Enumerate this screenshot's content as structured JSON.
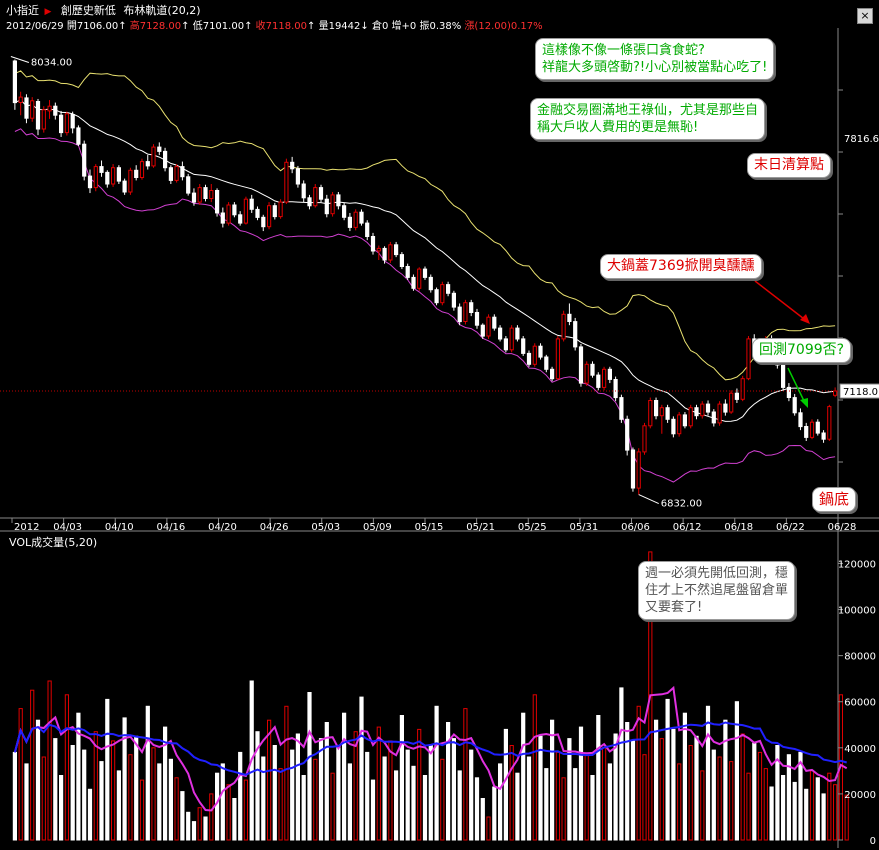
{
  "header": {
    "symbol": "小指近",
    "title": "創歷史新低",
    "indicator": "布林軌道(20,2)",
    "quote": {
      "date": "2012/06/29",
      "open_label": "開7106.00",
      "high_label": "高7128.00",
      "low_label": "低7101.00",
      "close_label": "收7118.00",
      "volume_label": "量19442",
      "oi_label": "倉0",
      "inc_label": "增+0",
      "amp_label": "振0.38%",
      "chg_label": "漲(12.00)0.17%"
    }
  },
  "volume_label": "VOL成交量(5,20)",
  "annotations": {
    "note1": "這樣像不像一條張口貪食蛇?\n祥龍大多頭啓動?!小心別被當點心吃了!",
    "note2": "金融交易圈滿地王祿仙，尤其是那些自\n稱大戶收人費用的更是無恥!",
    "note3": "末日清算點",
    "note4": "大鍋蓋7369掀開臭醺醺",
    "note5": "回測7099否?",
    "note6": "鍋底",
    "note7": "週一必須先開低回測，穩\n住才上不然追尾盤留倉單\n又要套了!",
    "peak_label": "8034.00",
    "trough_label": "6832.00",
    "right_price_label": "7816.6",
    "last_price_label": "7118.0"
  },
  "colors": {
    "up": "#e00000",
    "down": "#ffffff",
    "upper_band": "#e8e070",
    "middle_band": "#ffffff",
    "lower_band": "#d040d0",
    "ma5": "#e030e0",
    "ma20": "#2020ff",
    "green_text": "#00aa00",
    "red_text": "#dd0000"
  },
  "chart_data": [
    {
      "type": "candlestick",
      "x_ticks": [
        "2012",
        "04/03",
        "04/10",
        "04/16",
        "04/20",
        "04/26",
        "05/03",
        "05/09",
        "05/15",
        "05/21",
        "05/25",
        "05/31",
        "06/06",
        "06/12",
        "06/18",
        "06/22",
        "06/28"
      ],
      "ohlc": [
        [
          8030,
          8034,
          7895,
          7915
        ],
        [
          7915,
          7945,
          7880,
          7930
        ],
        [
          7928,
          7938,
          7858,
          7872
        ],
        [
          7872,
          7930,
          7862,
          7920
        ],
        [
          7918,
          7925,
          7825,
          7842
        ],
        [
          7842,
          7905,
          7832,
          7895
        ],
        [
          7892,
          7922,
          7870,
          7905
        ],
        [
          7905,
          7915,
          7868,
          7880
        ],
        [
          7880,
          7892,
          7820,
          7832
        ],
        [
          7832,
          7890,
          7824,
          7884
        ],
        [
          7882,
          7890,
          7830,
          7845
        ],
        [
          7845,
          7852,
          7795,
          7800
        ],
        [
          7800,
          7810,
          7700,
          7712
        ],
        [
          7712,
          7730,
          7665,
          7680
        ],
        [
          7680,
          7745,
          7670,
          7738
        ],
        [
          7738,
          7755,
          7710,
          7722
        ],
        [
          7722,
          7728,
          7680,
          7690
        ],
        [
          7690,
          7745,
          7682,
          7735
        ],
        [
          7735,
          7742,
          7690,
          7698
        ],
        [
          7698,
          7705,
          7660,
          7668
        ],
        [
          7668,
          7735,
          7660,
          7728
        ],
        [
          7728,
          7742,
          7700,
          7708
        ],
        [
          7708,
          7760,
          7702,
          7752
        ],
        [
          7752,
          7770,
          7730,
          7740
        ],
        [
          7740,
          7800,
          7735,
          7792
        ],
        [
          7792,
          7805,
          7770,
          7780
        ],
        [
          7780,
          7790,
          7725,
          7735
        ],
        [
          7735,
          7742,
          7690,
          7700
        ],
        [
          7700,
          7745,
          7694,
          7738
        ],
        [
          7738,
          7752,
          7700,
          7710
        ],
        [
          7710,
          7718,
          7658,
          7665
        ],
        [
          7665,
          7678,
          7630,
          7640
        ],
        [
          7640,
          7690,
          7632,
          7680
        ],
        [
          7680,
          7688,
          7642,
          7650
        ],
        [
          7650,
          7690,
          7640,
          7672
        ],
        [
          7672,
          7678,
          7600,
          7610
        ],
        [
          7610,
          7625,
          7570,
          7582
        ],
        [
          7582,
          7640,
          7575,
          7632
        ],
        [
          7632,
          7640,
          7598,
          7605
        ],
        [
          7605,
          7615,
          7575,
          7582
        ],
        [
          7582,
          7655,
          7578,
          7648
        ],
        [
          7648,
          7660,
          7610,
          7620
        ],
        [
          7620,
          7628,
          7590,
          7598
        ],
        [
          7598,
          7605,
          7560,
          7572
        ],
        [
          7572,
          7640,
          7565,
          7630
        ],
        [
          7630,
          7638,
          7592,
          7600
        ],
        [
          7600,
          7648,
          7594,
          7640
        ],
        [
          7640,
          7760,
          7635,
          7750
        ],
        [
          7750,
          7765,
          7720,
          7732
        ],
        [
          7732,
          7740,
          7680,
          7690
        ],
        [
          7690,
          7700,
          7640,
          7652
        ],
        [
          7652,
          7660,
          7620,
          7630
        ],
        [
          7630,
          7690,
          7625,
          7680
        ],
        [
          7680,
          7688,
          7640,
          7648
        ],
        [
          7648,
          7660,
          7598,
          7608
        ],
        [
          7608,
          7668,
          7600,
          7660
        ],
        [
          7660,
          7668,
          7620,
          7630
        ],
        [
          7630,
          7638,
          7590,
          7598
        ],
        [
          7598,
          7610,
          7560,
          7570
        ],
        [
          7570,
          7620,
          7562,
          7612
        ],
        [
          7612,
          7620,
          7575,
          7582
        ],
        [
          7582,
          7590,
          7535,
          7545
        ],
        [
          7545,
          7555,
          7495,
          7505
        ],
        [
          7505,
          7520,
          7480,
          7512
        ],
        [
          7512,
          7518,
          7470,
          7480
        ],
        [
          7480,
          7530,
          7472,
          7522
        ],
        [
          7522,
          7530,
          7488,
          7495
        ],
        [
          7495,
          7502,
          7455,
          7462
        ],
        [
          7462,
          7470,
          7425,
          7432
        ],
        [
          7432,
          7440,
          7395,
          7402
        ],
        [
          7402,
          7460,
          7395,
          7455
        ],
        [
          7455,
          7462,
          7425,
          7432
        ],
        [
          7432,
          7440,
          7390,
          7398
        ],
        [
          7398,
          7404,
          7355,
          7362
        ],
        [
          7362,
          7420,
          7355,
          7412
        ],
        [
          7412,
          7420,
          7380,
          7388
        ],
        [
          7388,
          7395,
          7340,
          7350
        ],
        [
          7350,
          7360,
          7300,
          7310
        ],
        [
          7310,
          7370,
          7302,
          7362
        ],
        [
          7362,
          7370,
          7325,
          7335
        ],
        [
          7335,
          7345,
          7290,
          7300
        ],
        [
          7300,
          7305,
          7262,
          7270
        ],
        [
          7270,
          7330,
          7262,
          7322
        ],
        [
          7322,
          7330,
          7285,
          7292
        ],
        [
          7292,
          7300,
          7255,
          7262
        ],
        [
          7262,
          7270,
          7225,
          7232
        ],
        [
          7232,
          7300,
          7225,
          7292
        ],
        [
          7292,
          7300,
          7255,
          7262
        ],
        [
          7262,
          7270,
          7215,
          7222
        ],
        [
          7222,
          7230,
          7185,
          7192
        ],
        [
          7192,
          7250,
          7185,
          7242
        ],
        [
          7242,
          7250,
          7205,
          7212
        ],
        [
          7212,
          7218,
          7170,
          7178
        ],
        [
          7178,
          7185,
          7145,
          7152
        ],
        [
          7152,
          7270,
          7148,
          7262
        ],
        [
          7262,
          7340,
          7255,
          7330
        ],
        [
          7330,
          7360,
          7300,
          7310
        ],
        [
          7310,
          7320,
          7230,
          7240
        ],
        [
          7240,
          7248,
          7130,
          7140
        ],
        [
          7140,
          7200,
          7132,
          7192
        ],
        [
          7192,
          7200,
          7155,
          7162
        ],
        [
          7162,
          7170,
          7120,
          7128
        ],
        [
          7128,
          7185,
          7120,
          7178
        ],
        [
          7178,
          7185,
          7140,
          7150
        ],
        [
          7150,
          7158,
          7090,
          7100
        ],
        [
          7100,
          7108,
          7030,
          7040
        ],
        [
          7040,
          7050,
          6940,
          6955
        ],
        [
          6955,
          6962,
          6840,
          6850
        ],
        [
          6850,
          6960,
          6832,
          6950
        ],
        [
          6950,
          7030,
          6942,
          7022
        ],
        [
          7022,
          7100,
          7015,
          7092
        ],
        [
          7092,
          7100,
          7040,
          7050
        ],
        [
          7050,
          7080,
          7000,
          7072
        ],
        [
          7072,
          7080,
          7030,
          7040
        ],
        [
          7040,
          7048,
          6990,
          7000
        ],
        [
          7000,
          7060,
          6992,
          7052
        ],
        [
          7052,
          7060,
          7015,
          7022
        ],
        [
          7022,
          7080,
          7015,
          7072
        ],
        [
          7072,
          7080,
          7040,
          7050
        ],
        [
          7050,
          7090,
          7042,
          7082
        ],
        [
          7082,
          7092,
          7050,
          7060
        ],
        [
          7060,
          7068,
          7020,
          7030
        ],
        [
          7030,
          7090,
          7022,
          7082
        ],
        [
          7082,
          7095,
          7050,
          7060
        ],
        [
          7060,
          7120,
          7055,
          7112
        ],
        [
          7112,
          7125,
          7085,
          7095
        ],
        [
          7095,
          7160,
          7090,
          7152
        ],
        [
          7152,
          7270,
          7148,
          7262
        ],
        [
          7262,
          7275,
          7220,
          7230
        ],
        [
          7230,
          7250,
          7210,
          7242
        ],
        [
          7242,
          7270,
          7235,
          7262
        ],
        [
          7262,
          7272,
          7225,
          7235
        ],
        [
          7235,
          7245,
          7180,
          7190
        ],
        [
          7190,
          7200,
          7120,
          7128
        ],
        [
          7128,
          7140,
          7090,
          7100
        ],
        [
          7100,
          7110,
          7050,
          7058
        ],
        [
          7058,
          7070,
          7010,
          7020
        ],
        [
          7020,
          7030,
          6980,
          6990
        ],
        [
          6990,
          7040,
          6985,
          7032
        ],
        [
          7032,
          7040,
          6995,
          7002
        ],
        [
          7002,
          7010,
          6975,
          6985
        ],
        [
          6985,
          7080,
          6980,
          7075
        ],
        [
          7106,
          7128,
          7101,
          7118
        ]
      ],
      "price_labels": {
        "peak": 8034.0,
        "trough": 6832.0,
        "right_axis": 7816.6,
        "last": 7118.0
      },
      "bollinger": {
        "period": 20,
        "k": 2
      },
      "xlabel": "",
      "ylabel": "",
      "ylim": [
        6770,
        8110
      ]
    },
    {
      "type": "bar",
      "title": "VOL成交量(5,20)",
      "y_ticks": [
        0,
        20000,
        40000,
        60000,
        80000,
        100000,
        120000
      ],
      "ylim": [
        0,
        128000
      ],
      "volumes": [
        38000,
        57000,
        33000,
        65000,
        52000,
        36000,
        69000,
        44000,
        28000,
        63000,
        41000,
        55000,
        39000,
        22000,
        47000,
        34000,
        61000,
        43000,
        30000,
        53000,
        37000,
        45000,
        26000,
        58000,
        40000,
        33000,
        49000,
        35000,
        27000,
        21000,
        12000,
        8000,
        14000,
        10000,
        20000,
        29000,
        33000,
        24000,
        18000,
        38000,
        26000,
        69000,
        47000,
        36000,
        52000,
        41000,
        31000,
        58000,
        39000,
        46000,
        28000,
        64000,
        35000,
        44000,
        51000,
        29000,
        40000,
        55000,
        33000,
        47000,
        62000,
        38000,
        26000,
        49000,
        36000,
        43000,
        30000,
        54000,
        39000,
        32000,
        48000,
        28000,
        41000,
        58000,
        35000,
        51000,
        44000,
        30000,
        57000,
        39000,
        27000,
        18000,
        10000,
        23000,
        33000,
        48000,
        41000,
        29000,
        55000,
        36000,
        63000,
        45000,
        31000,
        52000,
        38000,
        27000,
        44000,
        31000,
        49000,
        37000,
        28000,
        54000,
        40000,
        33000,
        46000,
        66000,
        51000,
        43000,
        58000,
        37000,
        125000,
        52000,
        44000,
        61000,
        48000,
        33000,
        55000,
        41000,
        45000,
        30000,
        58000,
        39000,
        36000,
        52000,
        34000,
        60000,
        46000,
        29000,
        42000,
        38000,
        31000,
        23000,
        41000,
        28000,
        37000,
        25000,
        38000,
        22000,
        30000,
        27000,
        20000,
        29000,
        24000,
        63000,
        19500
      ]
    }
  ]
}
